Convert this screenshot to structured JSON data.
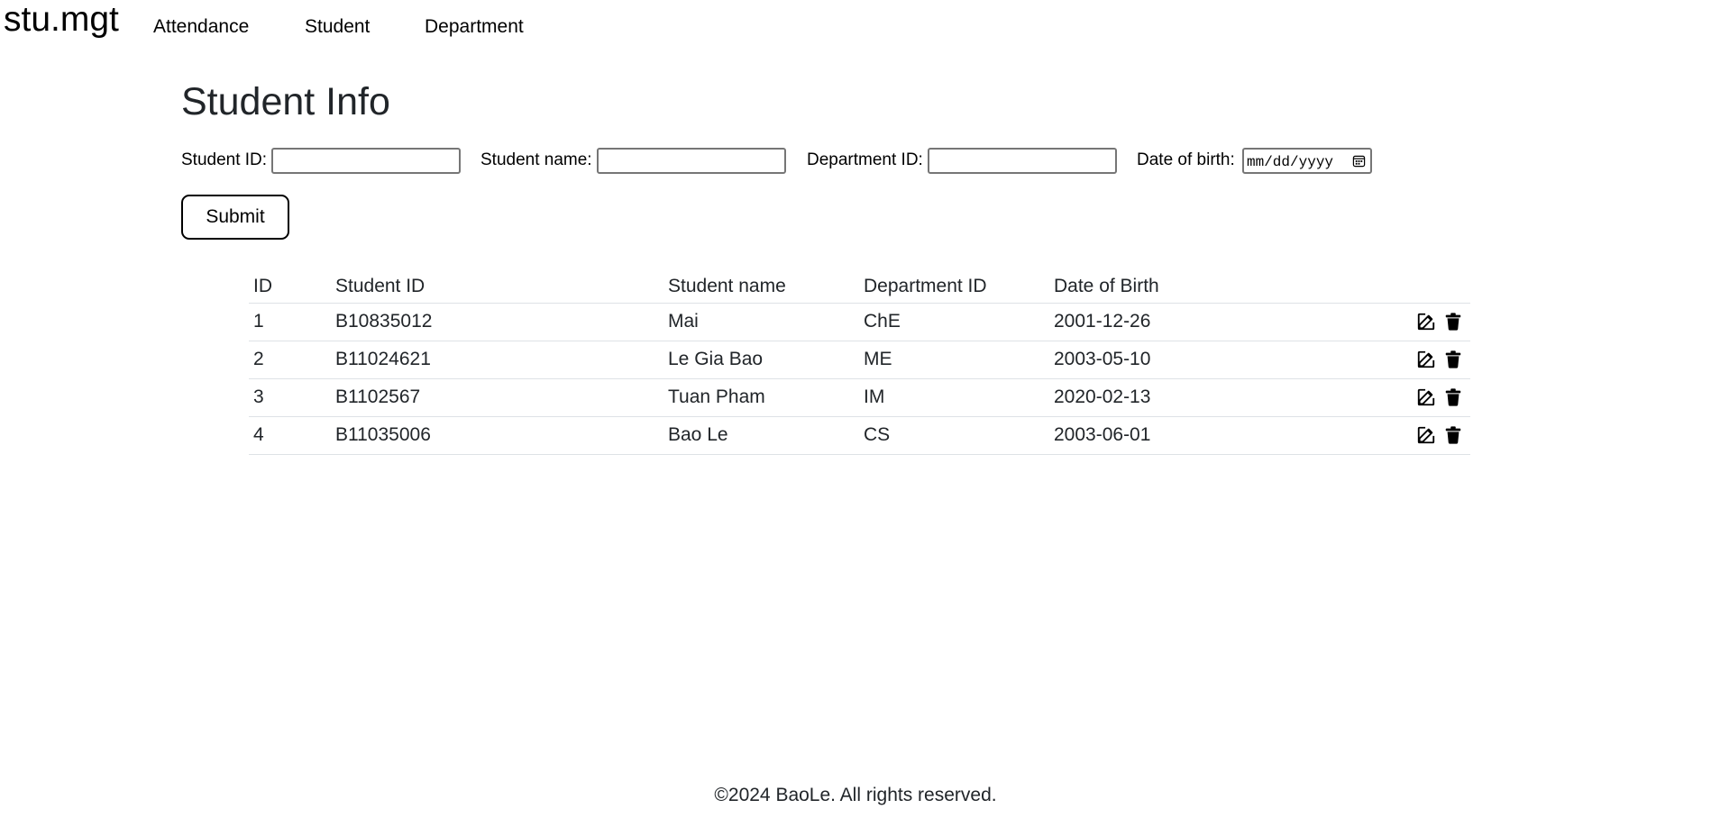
{
  "navbar": {
    "brand": "stu.mgt",
    "links": [
      "Attendance",
      "Student",
      "Department"
    ]
  },
  "page": {
    "title": "Student Info"
  },
  "form": {
    "student_id_label": "Student ID:",
    "student_name_label": "Student name:",
    "department_id_label": "Department ID:",
    "dob_label": "Date of birth:",
    "dob_placeholder": "mm/dd/yyyy",
    "submit_label": "Submit"
  },
  "table": {
    "headers": [
      "ID",
      "Student ID",
      "Student name",
      "Department ID",
      "Date of Birth"
    ],
    "rows": [
      [
        "1",
        "B10835012",
        "Mai",
        "ChE",
        "2001-12-26"
      ],
      [
        "2",
        "B11024621",
        "Le Gia Bao",
        "ME",
        "2003-05-10"
      ],
      [
        "3",
        "B1102567",
        "Tuan Pham",
        "IM",
        "2020-02-13"
      ],
      [
        "4",
        "B11035006",
        "Bao Le",
        "CS",
        "2003-06-01"
      ]
    ],
    "row_action_icons": [
      "edit-icon",
      "trash-icon"
    ]
  },
  "footer": {
    "text": "©2024 BaoLe. All rights reserved."
  }
}
